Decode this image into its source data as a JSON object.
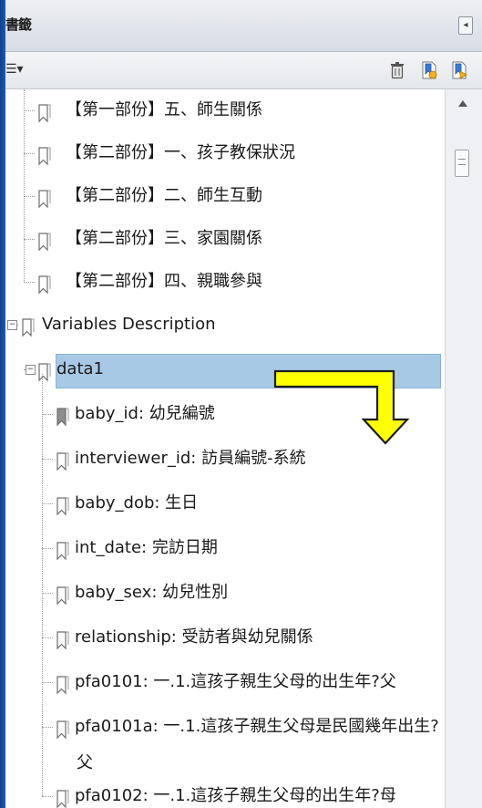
{
  "panel": {
    "title": "書籤",
    "collapse_glyph": "◂",
    "options_glyph": "☰▾"
  },
  "toolbar": {
    "icons": [
      "trash-icon",
      "new-bookmark-icon",
      "bookmark-from-selection-icon"
    ]
  },
  "tree": {
    "items": [
      {
        "label": "【第一部份】五、師生關係"
      },
      {
        "label": "【第二部份】一、孩子教保狀況"
      },
      {
        "label": "【第二部份】二、師生互動"
      },
      {
        "label": "【第二部份】三、家園關係"
      },
      {
        "label": "【第二部份】四、親職參與"
      },
      {
        "label": "Variables Description"
      },
      {
        "label": "data1"
      },
      {
        "label": "baby_id: 幼兒編號"
      },
      {
        "label": "interviewer_id: 訪員編號-系統"
      },
      {
        "label": "baby_dob: 生日"
      },
      {
        "label": "int_date: 完訪日期"
      },
      {
        "label": "baby_sex: 幼兒性別"
      },
      {
        "label": "relationship: 受訪者與幼兒關係"
      },
      {
        "label": "pfa0101: 一.1.這孩子親生父母的出生年?父"
      },
      {
        "label": "pfa0101a: 一.1.這孩子親生父母是民國幾年出生?"
      },
      {
        "label": "父"
      },
      {
        "label": "pfa0102: 一.1.這孩子親生父母的出生年?母"
      }
    ]
  },
  "colors": {
    "selection": "#a8c9e6",
    "annotation_arrow": "#ffff00",
    "window_edge": "#1a4f9e"
  }
}
